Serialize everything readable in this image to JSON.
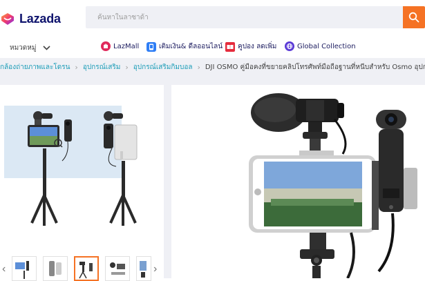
{
  "header": {
    "logo_text": "Lazada",
    "search": {
      "placeholder": "ค้นหาในลาซาด้า"
    },
    "colors": {
      "brand_navy": "#0f146d",
      "accent_orange": "#f57224"
    }
  },
  "nav": {
    "category_label": "หมวดหมู่",
    "links": [
      {
        "label": "LazMall",
        "icon": "lazmall-icon",
        "color": "#e0295b"
      },
      {
        "label": "เติมเงิน& ดีลออนไลน์",
        "icon": "topup-icon",
        "color": "#2f7ef5"
      },
      {
        "label": "คูปอง ลดเพิ่ม",
        "icon": "voucher-icon",
        "color": "#e52c3d"
      },
      {
        "label": "Global Collection",
        "icon": "global-collection-icon",
        "color": "#5b3bd6"
      }
    ]
  },
  "breadcrumb": {
    "items": [
      "กล้องถ่ายภาพและโดรน",
      "อุปกรณ์เสริม",
      "อุปกรณ์เสริมกิมบอล"
    ],
    "current": "DJI OSMO คู่มือคงที่ขยายคลิปโทรศัพท์มือถือฐานที่หนีบสำหรับ Osmo อุปกรณ์เสริมกล้อง"
  },
  "gallery": {
    "active_thumb": 3,
    "thumb_count": 5
  }
}
